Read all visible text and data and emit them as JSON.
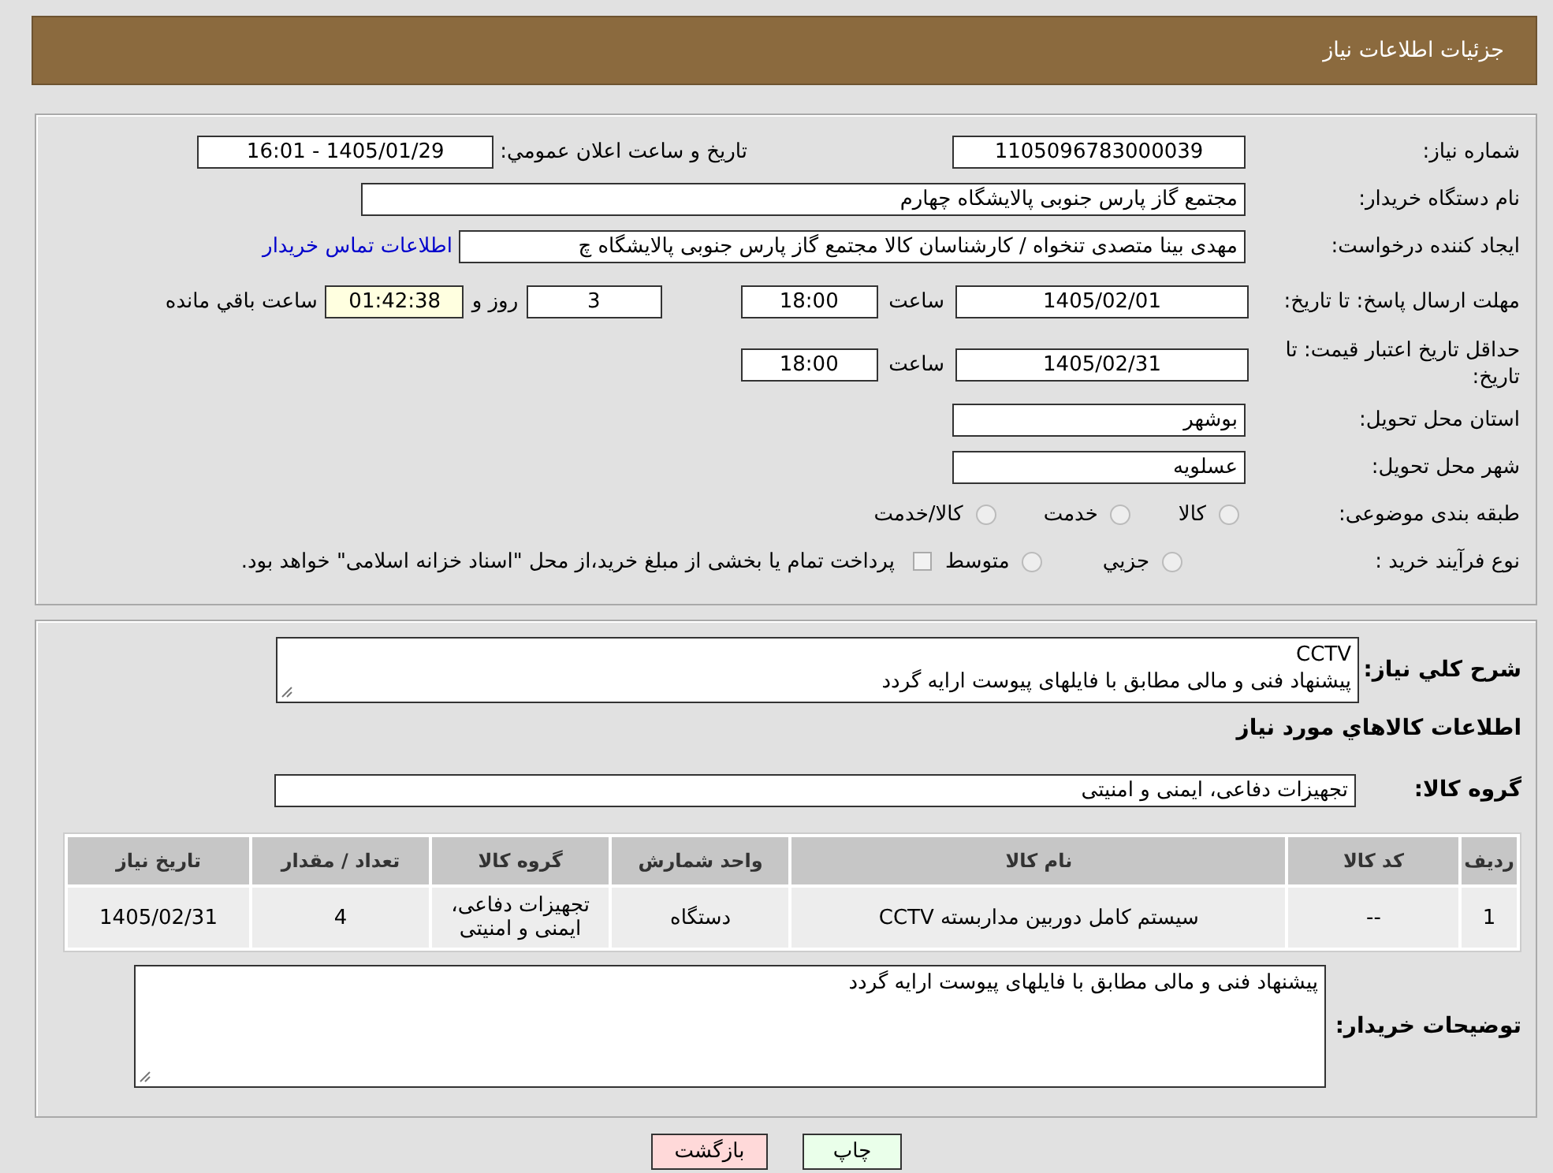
{
  "header": {
    "title": "جزئیات اطلاعات نیاز"
  },
  "details": {
    "need_number": {
      "label": "شماره نیاز:",
      "value": "1105096783000039"
    },
    "announce": {
      "label": "تاریخ و ساعت اعلان عمومي:",
      "value": "1405/01/29 - 16:01"
    },
    "buyer_org": {
      "label": "نام دستگاه خریدار:",
      "value": "مجتمع گاز پارس جنوبی  پالایشگاه چهارم"
    },
    "requester": {
      "label": "ایجاد کننده درخواست:",
      "value": "مهدی بینا متصدی تنخواه / کارشناسان کالا مجتمع گاز پارس جنوبی  پالایشگاه چ",
      "link": "اطلاعات تماس خریدار"
    },
    "reply_deadline": {
      "label": "مهلت ارسال پاسخ: تا تاریخ:",
      "date": "1405/02/01",
      "time_label": "ساعت",
      "time": "18:00",
      "days": "3",
      "days_label": "روز و",
      "remaining": "01:42:38",
      "remaining_label": "ساعت باقي مانده"
    },
    "validity": {
      "label": "حداقل تاریخ اعتبار قیمت: تا تاریخ:",
      "date": "1405/02/31",
      "time_label": "ساعت",
      "time": "18:00"
    },
    "province": {
      "label": "استان محل تحویل:",
      "value": "بوشهر"
    },
    "city": {
      "label": "شهر محل تحویل:",
      "value": "عسلویه"
    },
    "category": {
      "label": "طبقه بندی موضوعی:",
      "options": [
        {
          "label": "کالا",
          "selected": false
        },
        {
          "label": "خدمت",
          "selected": false
        },
        {
          "label": "کالا/خدمت",
          "selected": false
        }
      ]
    },
    "process": {
      "label": "نوع فرآیند خرید :",
      "options": [
        {
          "label": "جزيي",
          "selected": false
        },
        {
          "label": "متوسط",
          "selected": false
        }
      ],
      "payment_note": {
        "checked": false,
        "text": "پرداخت تمام یا بخشی از مبلغ خرید،از محل \"اسناد خزانه اسلامی\" خواهد بود."
      }
    }
  },
  "description": {
    "label": "شرح كلي نياز:",
    "lines": [
      "CCTV",
      "پیشنهاد فنی و مالی مطابق با فایلهای پیوست ارایه گردد"
    ]
  },
  "goods_heading": "اطلاعات كالاهاي مورد نياز",
  "goods_group": {
    "label": "گروه کالا:",
    "value": "تجهیزات دفاعی، ایمنی و امنیتی"
  },
  "table": {
    "columns": [
      "ردیف",
      "کد کالا",
      "نام کالا",
      "واحد شمارش",
      "گروه کالا",
      "تعداد / مقدار",
      "تاریخ نیاز"
    ],
    "rows": [
      [
        "1",
        "--",
        "سیستم کامل دوربین مداربسته CCTV",
        "دستگاه",
        "تجهیزات دفاعی، ایمنی و امنیتی",
        "4",
        "1405/02/31"
      ]
    ]
  },
  "buyer_notes": {
    "label": "توضیحات خریدار:",
    "value": "پیشنهاد فنی و مالی مطابق با فایلهای پیوست ارایه گردد"
  },
  "buttons": [
    {
      "label": "چاپ",
      "kind": "print"
    },
    {
      "label": "بازگشت",
      "kind": "back"
    }
  ]
}
